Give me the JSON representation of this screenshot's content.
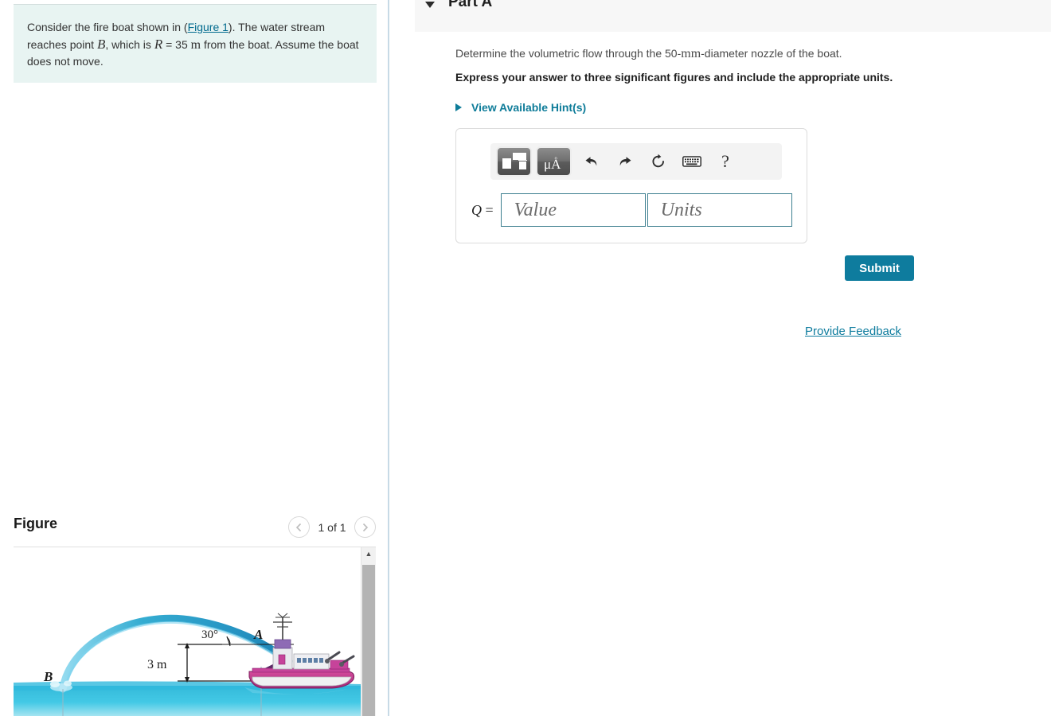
{
  "problem": {
    "text_part1": "Consider the fire boat shown in (",
    "figure_link": "Figure 1",
    "text_part2": "). The water stream reaches point ",
    "var_B": "B",
    "text_part3": ", which is ",
    "var_R": "R",
    "text_part4": " = 35 ",
    "unit_m": "m",
    "text_part5": " from the boat. Assume the boat does not move."
  },
  "figure": {
    "title": "Figure",
    "counter": "1 of 1",
    "prev_icon": "chevron-left-icon",
    "next_icon": "chevron-right-icon",
    "scroll_up_glyph": "▲",
    "labels": {
      "point_b": "B",
      "point_a": "A",
      "angle": "30°",
      "height": "3 m"
    }
  },
  "part": {
    "title": "Part A",
    "collapse_icon": "caret-down-icon",
    "question_pre": "Determine the volumetric flow through the 50-",
    "question_unit": "mm",
    "question_post": "-diameter nozzle of the boat.",
    "express": "Express your answer to three significant figures and include the appropriate units.",
    "hints_label": "View Available Hint(s)"
  },
  "answer": {
    "q_label_var": "Q",
    "q_label_eq": " =",
    "value_placeholder": "Value",
    "units_placeholder": "Units",
    "value": "",
    "units": "",
    "toolbar": {
      "template_title": "template-button",
      "units_glyph_mu": "μ",
      "units_glyph_a": "A",
      "units_glyph_ring": "°",
      "undo": "↰",
      "redo": "↱",
      "reset": "↻",
      "keyboard": "⌨",
      "help": "?"
    }
  },
  "actions": {
    "submit_label": "Submit",
    "feedback_label": "Provide Feedback"
  },
  "colors": {
    "accent": "#0e7c9e",
    "problem_bg": "#e8f4f2",
    "input_border": "#3d7f8f",
    "divider": "#c7dae6"
  }
}
